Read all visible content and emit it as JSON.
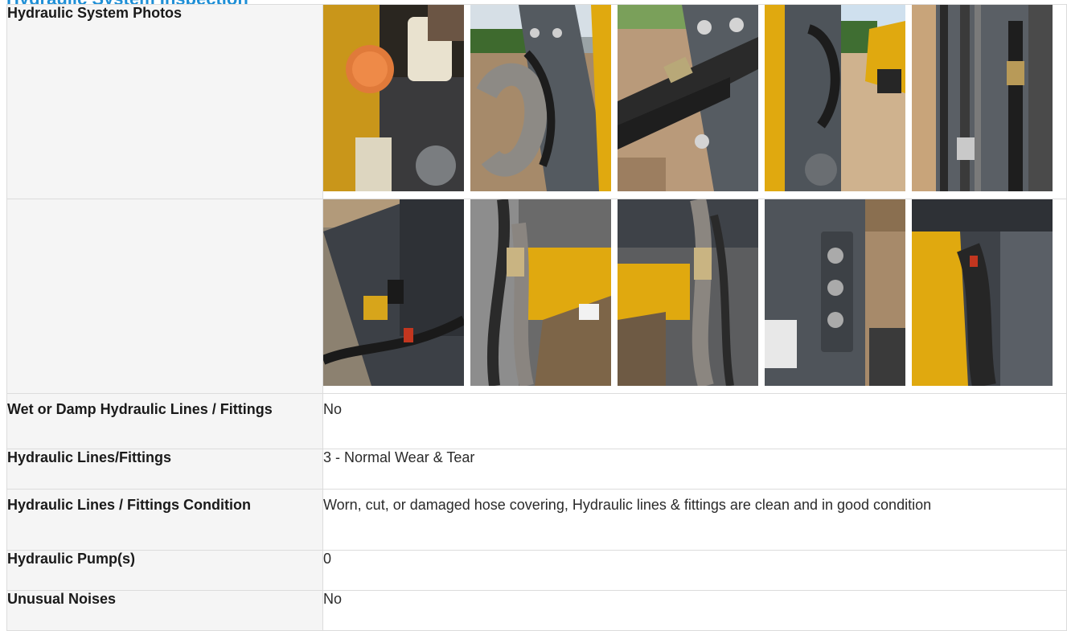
{
  "section": {
    "title": "Hydraulic System Inspection"
  },
  "photos": {
    "label": "Hydraulic System Photos",
    "row1": [
      "photo-engine-bay-cap",
      "photo-boom-hose-wrap",
      "photo-hose-fittings-plate",
      "photo-boom-arm-loader",
      "photo-vertical-lines"
    ],
    "row2": [
      "photo-cab-side-frame",
      "photo-yellow-frame-hoses",
      "photo-frame-hose-wrap",
      "photo-coupler-plate-decal",
      "photo-yellow-panel-hose"
    ]
  },
  "rows": [
    {
      "label": "Wet or Damp Hydraulic Lines / Fittings",
      "value": "No"
    },
    {
      "label": "Hydraulic Lines/Fittings",
      "value": "3 - Normal Wear & Tear"
    },
    {
      "label": "Hydraulic Lines / Fittings Condition",
      "value": "Worn, cut, or damaged hose covering, Hydraulic lines & fittings are clean and in good condition"
    },
    {
      "label": "Hydraulic Pump(s)",
      "value": "0"
    },
    {
      "label": "Unusual Noises",
      "value": "No"
    }
  ],
  "colors": {
    "title": "#1e8fd6",
    "label_bg": "#f5f5f5",
    "border": "#dcdcdc",
    "machine_yellow": "#e0a90f",
    "steel_gray": "#4a4f56"
  }
}
